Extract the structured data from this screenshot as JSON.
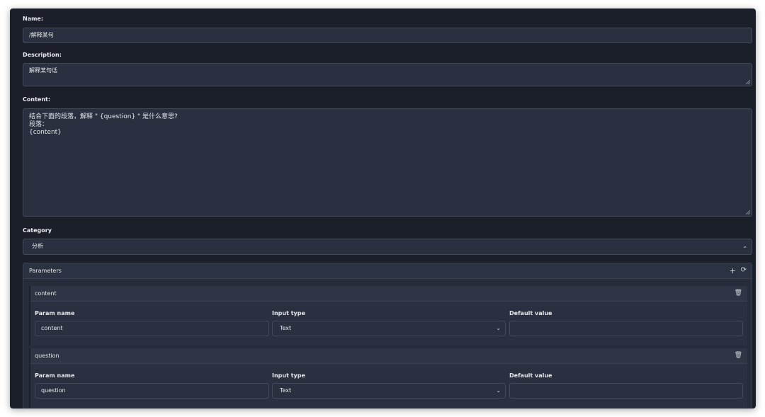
{
  "form": {
    "name_label": "Name:",
    "name_value": "/解释某句",
    "description_label": "Description:",
    "description_value": "解释某句话",
    "content_label": "Content:",
    "content_value": "结合下面的段落，解释 \" {question} \" 是什么意思?\n段落：\n{content}",
    "category_label": "Category",
    "category_value": "分析"
  },
  "parameters": {
    "title": "Parameters",
    "add_icon": "plus-icon",
    "refresh_icon": "refresh-icon",
    "items": [
      {
        "name": "content",
        "param_name_label": "Param name",
        "param_name_value": "content",
        "input_type_label": "Input type",
        "input_type_value": "Text",
        "default_value_label": "Default value",
        "default_value_value": "",
        "delete_icon": "trash-icon"
      },
      {
        "name": "question",
        "param_name_label": "Param name",
        "param_name_value": "question",
        "input_type_label": "Input type",
        "input_type_value": "Text",
        "default_value_label": "Default value",
        "default_value_value": "",
        "delete_icon": "trash-icon"
      }
    ]
  }
}
